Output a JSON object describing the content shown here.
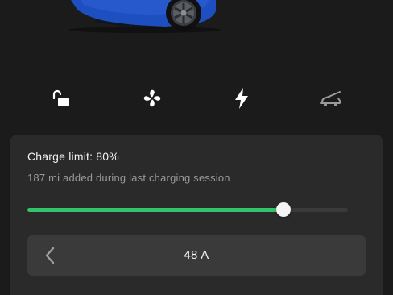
{
  "vehicle": {
    "image": "car-image",
    "paint_color": "#1e4fc0"
  },
  "quick_controls": [
    {
      "name": "lock",
      "icon": "unlocked-icon"
    },
    {
      "name": "climate",
      "icon": "fan-icon"
    },
    {
      "name": "charge",
      "icon": "lightning-icon"
    },
    {
      "name": "frunk",
      "icon": "frunk-icon"
    }
  ],
  "charging": {
    "charge_limit_label": "Charge limit: 80%",
    "session_text": "187 mi added during last charging session",
    "charge_limit_percent": 80,
    "slider_fill_color": "#31c46b",
    "current_value": "48 A",
    "decrease_icon": "chevron-left-icon"
  }
}
